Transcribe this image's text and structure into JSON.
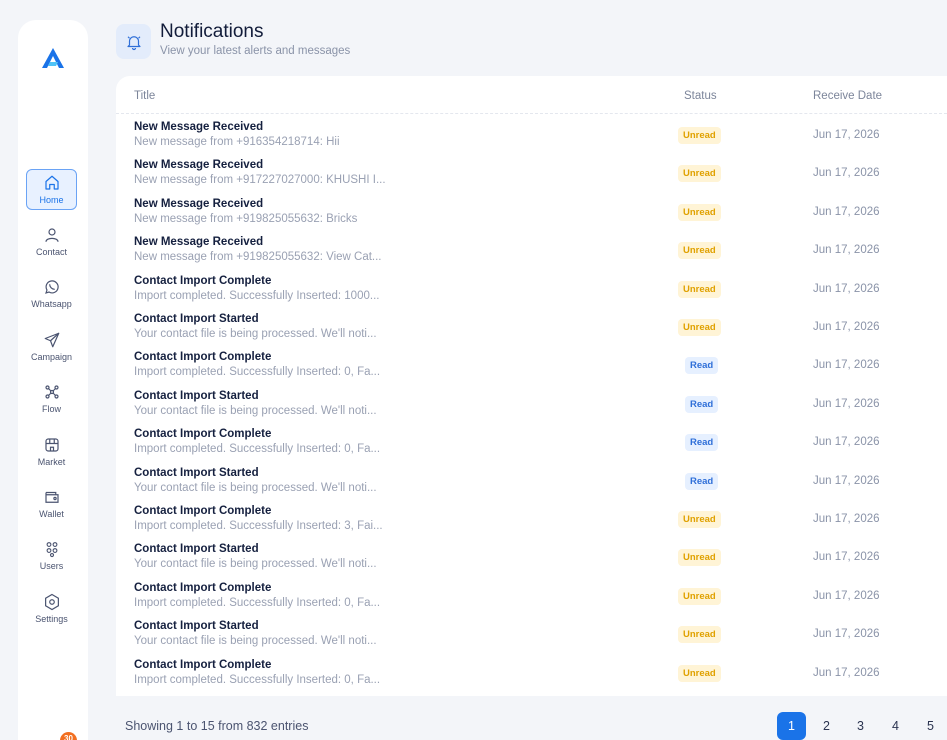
{
  "header": {
    "title": "Notifications",
    "subtitle": "View your latest alerts and messages",
    "icon": "bell-icon"
  },
  "sidebar": {
    "badge_count": "30",
    "items": [
      {
        "label": "Home",
        "icon": "home-icon",
        "active": true
      },
      {
        "label": "Contact",
        "icon": "user-icon"
      },
      {
        "label": "Whatsapp",
        "icon": "whatsapp-icon"
      },
      {
        "label": "Campaign",
        "icon": "send-icon"
      },
      {
        "label": "Flow",
        "icon": "flow-icon"
      },
      {
        "label": "Market",
        "icon": "store-icon"
      },
      {
        "label": "Wallet",
        "icon": "wallet-icon"
      },
      {
        "label": "Users",
        "icon": "users-icon"
      },
      {
        "label": "Settings",
        "icon": "settings-icon"
      }
    ]
  },
  "table": {
    "columns": {
      "title": "Title",
      "status": "Status",
      "date": "Receive Date"
    },
    "rows": [
      {
        "title": "New Message Received",
        "message": "New message from +916354218714: Hii",
        "status": "Unread",
        "date": "Jun 17, 2026"
      },
      {
        "title": "New Message Received",
        "message": "New message from +917227027000: KHUSHI I...",
        "status": "Unread",
        "date": "Jun 17, 2026"
      },
      {
        "title": "New Message Received",
        "message": "New message from +919825055632: Bricks",
        "status": "Unread",
        "date": "Jun 17, 2026"
      },
      {
        "title": "New Message Received",
        "message": "New message from +919825055632: View Cat...",
        "status": "Unread",
        "date": "Jun 17, 2026"
      },
      {
        "title": "Contact Import Complete",
        "message": "Import completed. Successfully Inserted: 1000...",
        "status": "Unread",
        "date": "Jun 17, 2026"
      },
      {
        "title": "Contact Import Started",
        "message": "Your contact file is being processed. We'll noti...",
        "status": "Unread",
        "date": "Jun 17, 2026"
      },
      {
        "title": "Contact Import Complete",
        "message": "Import completed. Successfully Inserted: 0, Fa...",
        "status": "Read",
        "date": "Jun 17, 2026"
      },
      {
        "title": "Contact Import Started",
        "message": "Your contact file is being processed. We'll noti...",
        "status": "Read",
        "date": "Jun 17, 2026"
      },
      {
        "title": "Contact Import Complete",
        "message": "Import completed. Successfully Inserted: 0, Fa...",
        "status": "Read",
        "date": "Jun 17, 2026"
      },
      {
        "title": "Contact Import Started",
        "message": "Your contact file is being processed. We'll noti...",
        "status": "Read",
        "date": "Jun 17, 2026"
      },
      {
        "title": "Contact Import Complete",
        "message": "Import completed. Successfully Inserted: 3, Fai...",
        "status": "Unread",
        "date": "Jun 17, 2026"
      },
      {
        "title": "Contact Import Started",
        "message": "Your contact file is being processed. We'll noti...",
        "status": "Unread",
        "date": "Jun 17, 2026"
      },
      {
        "title": "Contact Import Complete",
        "message": "Import completed. Successfully Inserted: 0, Fa...",
        "status": "Unread",
        "date": "Jun 17, 2026"
      },
      {
        "title": "Contact Import Started",
        "message": "Your contact file is being processed. We'll noti...",
        "status": "Unread",
        "date": "Jun 17, 2026"
      },
      {
        "title": "Contact Import Complete",
        "message": "Import completed. Successfully Inserted: 0, Fa...",
        "status": "Unread",
        "date": "Jun 17, 2026"
      }
    ]
  },
  "pagination": {
    "summary": "Showing 1 to 15 from 832 entries",
    "pages": [
      "1",
      "2",
      "3",
      "4",
      "5"
    ],
    "current": "1"
  },
  "colors": {
    "accent": "#1a73e8",
    "unread_bg": "#fff4d6",
    "unread_text": "#e0a100",
    "read_bg": "#e6f0ff",
    "read_text": "#2f6fd8",
    "badge": "#f26f21"
  }
}
